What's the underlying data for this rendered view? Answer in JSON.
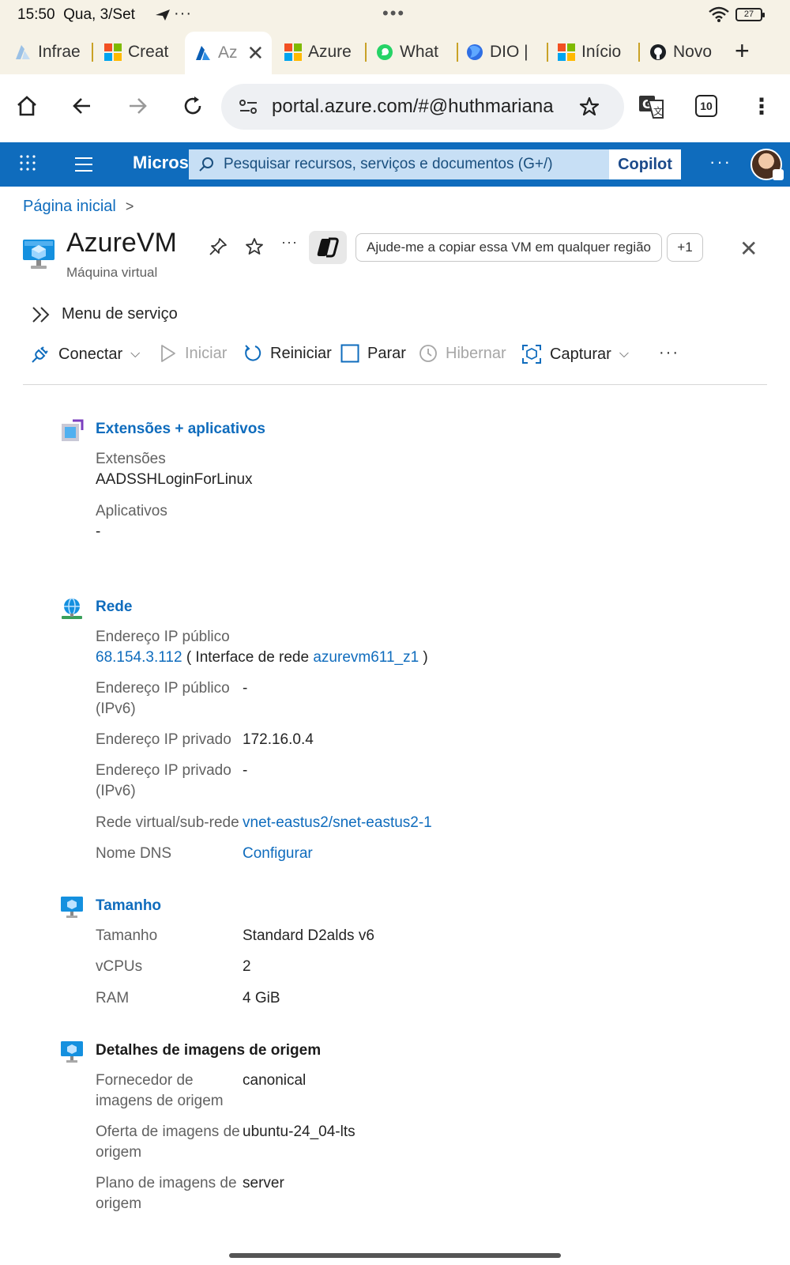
{
  "status_bar": {
    "time": "15:50",
    "date": "Qua, 3/Set",
    "dots": "•••",
    "battery": "27"
  },
  "tabs": [
    {
      "label": "Infrae",
      "icon": "azure-a-icon"
    },
    {
      "label": "Creat",
      "icon": "microsoft-logo-icon"
    },
    {
      "label": "Az",
      "icon": "azure-a-icon",
      "active": true
    },
    {
      "label": "Azure",
      "icon": "microsoft-logo-icon"
    },
    {
      "label": "What",
      "icon": "whatsapp-icon"
    },
    {
      "label": "DIO |",
      "icon": "dio-icon"
    },
    {
      "label": "Início",
      "icon": "microsoft-logo-icon"
    },
    {
      "label": "Novo",
      "icon": "github-icon"
    }
  ],
  "address_bar": {
    "url": "portal.azure.com/#@huthmariana",
    "tab_count": "10"
  },
  "azure_header": {
    "brand": "Micros",
    "search_placeholder": "Pesquisar recursos, serviços e documentos (G+/)",
    "copilot_label": "Copilot",
    "more": "···"
  },
  "breadcrumb": {
    "home": "Página inicial",
    "separator": ">"
  },
  "resource": {
    "name": "AzureVM",
    "type": "Máquina virtual",
    "copilot_suggestion": "Ajude-me a copiar essa VM em qualquer região",
    "more_suggestions": "+1",
    "more": "···"
  },
  "service_menu_label": "Menu de serviço",
  "toolbar": {
    "connect": "Conectar",
    "start": "Iniciar",
    "restart": "Reiniciar",
    "stop": "Parar",
    "hibernate": "Hibernar",
    "capture": "Capturar",
    "more": "···"
  },
  "extensions_section": {
    "title": "Extensões + aplicativos",
    "extensions_label": "Extensões",
    "extensions_value": "AADSSHLoginForLinux",
    "apps_label": "Aplicativos",
    "apps_value": "-"
  },
  "network_section": {
    "title": "Rede",
    "public_ip_label": "Endereço IP público",
    "public_ip_value": "68.154.3.112",
    "nic_prefix": "( Interface de rede",
    "nic_value": "azurevm611_z1",
    "nic_suffix": ")",
    "public_ipv6_label_1": "Endereço IP público",
    "public_ipv6_label_2": "(IPv6)",
    "public_ipv6_value": "-",
    "private_ip_label": "Endereço IP privado",
    "private_ip_value": "172.16.0.4",
    "private_ipv6_label_1": "Endereço IP privado",
    "private_ipv6_label_2": "(IPv6)",
    "private_ipv6_value": "-",
    "vnet_label": "Rede virtual/sub-rede",
    "vnet_value": "vnet-eastus2/snet-eastus2-1",
    "dns_label": "Nome DNS",
    "dns_value": "Configurar"
  },
  "size_section": {
    "title": "Tamanho",
    "size_label": "Tamanho",
    "size_value": "Standard D2alds v6",
    "vcpus_label": "vCPUs",
    "vcpus_value": "2",
    "ram_label": "RAM",
    "ram_value": "4 GiB"
  },
  "image_section": {
    "title": "Detalhes de imagens de origem",
    "publisher_label_1": "Fornecedor de",
    "publisher_label_2": "imagens de origem",
    "publisher_value": "canonical",
    "offer_label_1": "Oferta de imagens de",
    "offer_label_2": "origem",
    "offer_value": "ubuntu-24_04-lts",
    "plan_label_1": "Plano de imagens de",
    "plan_label_2": "origem",
    "plan_value": "server"
  },
  "colors": {
    "azure_blue": "#0f6cbd",
    "browser_chrome": "#f6f2e6",
    "disabled": "#a6a6a6"
  }
}
